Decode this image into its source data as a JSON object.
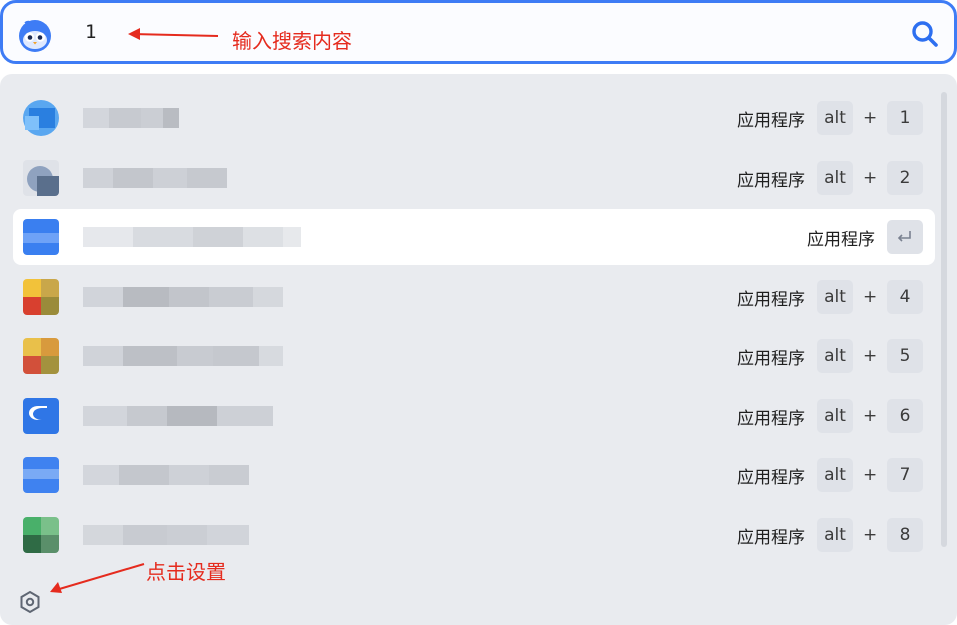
{
  "search": {
    "query": "1",
    "logo_icon": "bird-avatar-icon",
    "search_icon": "magnifier-icon",
    "accent_color": "#3e7cf5"
  },
  "results": [
    {
      "type_label": "应用程序",
      "mod": "alt",
      "plus": "+",
      "num": "1",
      "selected": false
    },
    {
      "type_label": "应用程序",
      "mod": "alt",
      "plus": "+",
      "num": "2",
      "selected": false
    },
    {
      "type_label": "应用程序",
      "selected": true,
      "enter_icon": "enter-return-icon"
    },
    {
      "type_label": "应用程序",
      "mod": "alt",
      "plus": "+",
      "num": "4",
      "selected": false
    },
    {
      "type_label": "应用程序",
      "mod": "alt",
      "plus": "+",
      "num": "5",
      "selected": false
    },
    {
      "type_label": "应用程序",
      "mod": "alt",
      "plus": "+",
      "num": "6",
      "selected": false
    },
    {
      "type_label": "应用程序",
      "mod": "alt",
      "plus": "+",
      "num": "7",
      "selected": false
    },
    {
      "type_label": "应用程序",
      "mod": "alt",
      "plus": "+",
      "num": "8",
      "selected": false
    }
  ],
  "footer": {
    "settings_icon": "hexagon-settings-icon"
  },
  "annotations": {
    "search_hint": "输入搜索内容",
    "settings_hint": "点击设置",
    "color": "#e52b1e"
  }
}
